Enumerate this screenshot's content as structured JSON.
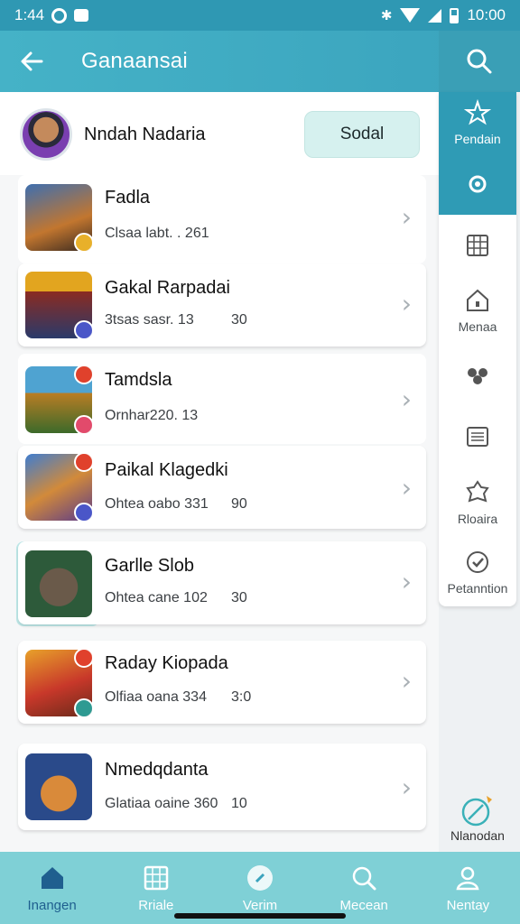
{
  "status_bar": {
    "time_left": "1:44",
    "time_right": "10:00"
  },
  "app_bar": {
    "back_icon": "back-arrow-icon",
    "title": "Ganaansai",
    "search_icon": "search-icon"
  },
  "profile": {
    "name": "Nndah Nadaria",
    "button_label": "Sodal"
  },
  "games": [
    {
      "title": "Fadla",
      "meta": "Clsaa labt. . 261",
      "rating": ""
    },
    {
      "title": "Gakal Rarpadai",
      "meta": "3tsas sasr. 13",
      "rating": "30"
    },
    {
      "title": "Tamdsla",
      "meta": "Ornhar220. 13",
      "rating": ""
    },
    {
      "title": "Paikal Klagedki",
      "meta": "Ohtea oabo 331",
      "rating": "90"
    },
    {
      "title": "Garlle Slob",
      "meta": "Ohtea cane 102",
      "rating": "30"
    },
    {
      "title": "Raday Kiopada",
      "meta": "Olfiaa oana 334",
      "rating": "3:0"
    },
    {
      "title": "Nmedqdanta",
      "meta": "Glatiaa oaine 360",
      "rating": "10"
    }
  ],
  "rail": {
    "items": [
      {
        "label": "Pendain",
        "icon": "star-icon"
      },
      {
        "label": "",
        "icon": "gear-icon"
      },
      {
        "label": "",
        "icon": "grid-icon"
      },
      {
        "label": "Menaa",
        "icon": "home-icon"
      },
      {
        "label": "",
        "icon": "flower-icon"
      },
      {
        "label": "",
        "icon": "list-icon"
      },
      {
        "label": "Rloaira",
        "icon": "badge-icon"
      },
      {
        "label": "Petanntion",
        "icon": "check-circle-icon"
      }
    ],
    "bottom_label": "Nlanodan"
  },
  "bottom_nav": [
    {
      "label": "Inangen",
      "icon": "home-icon"
    },
    {
      "label": "Rriale",
      "icon": "grid-icon"
    },
    {
      "label": "Verim",
      "icon": "compass-icon"
    },
    {
      "label": "Mecean",
      "icon": "search-icon"
    },
    {
      "label": "Nentay",
      "icon": "person-icon"
    }
  ],
  "colors": {
    "primary": "#3aa3bd",
    "nav_bg": "#7fd0d6",
    "accent_light": "#d6f1ef"
  }
}
